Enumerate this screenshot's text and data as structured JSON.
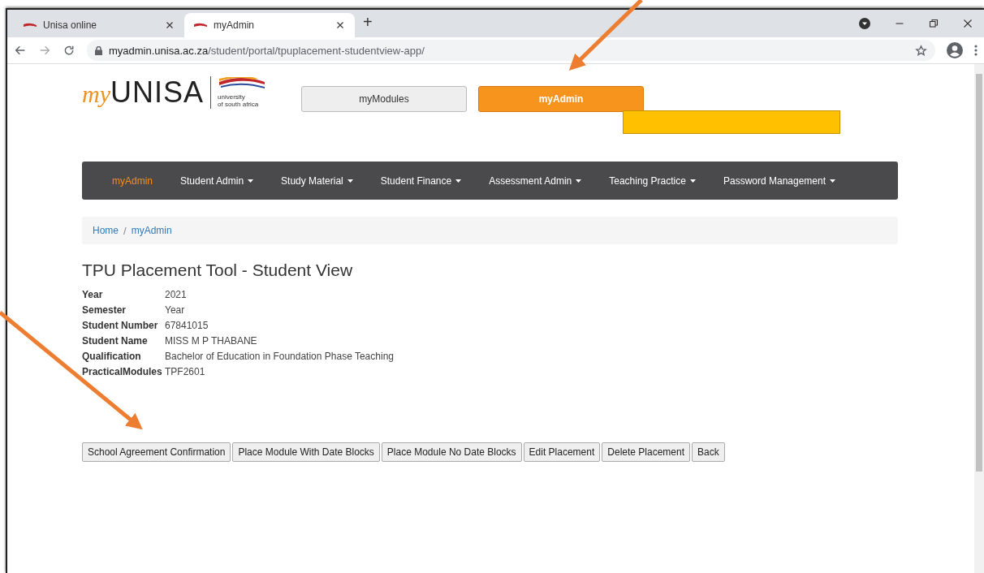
{
  "browser": {
    "tabs": [
      {
        "title": "Unisa online",
        "selected": false
      },
      {
        "title": "myAdmin",
        "selected": true
      }
    ],
    "new_tab": "+",
    "url_host": "myadmin.unisa.ac.za",
    "url_path": "/student/portal/tpuplacement-studentview-app/"
  },
  "header": {
    "logo_my": "my",
    "logo_name": "UNISA",
    "logo_sub": [
      "university",
      "of south africa"
    ],
    "portal_buttons": [
      {
        "label": "myModules",
        "selected": false
      },
      {
        "label": "myAdmin",
        "selected": true
      }
    ]
  },
  "nav": {
    "items": [
      {
        "label": "myAdmin",
        "selected": true,
        "dropdown": false
      },
      {
        "label": "Student Admin",
        "selected": false,
        "dropdown": true
      },
      {
        "label": "Study Material",
        "selected": false,
        "dropdown": true
      },
      {
        "label": "Student Finance",
        "selected": false,
        "dropdown": true
      },
      {
        "label": "Assessment Admin",
        "selected": false,
        "dropdown": true
      },
      {
        "label": "Teaching Practice",
        "selected": false,
        "dropdown": true
      },
      {
        "label": "Password Management",
        "selected": false,
        "dropdown": true
      }
    ]
  },
  "breadcrumb": {
    "separator": "/",
    "items": [
      "Home",
      "myAdmin"
    ]
  },
  "title": "TPU Placement Tool - Student View",
  "details": [
    {
      "label": "Year",
      "value": "2021"
    },
    {
      "label": "Semester",
      "value": "Year"
    },
    {
      "label": "Student Number",
      "value": "67841015"
    },
    {
      "label": "Student Name",
      "value": "MISS M P THABANE"
    },
    {
      "label": "Qualification",
      "value": "Bachelor of Education in Foundation Phase Teaching"
    },
    {
      "label": "PracticalModules",
      "value": "TPF2601"
    }
  ],
  "actions": [
    "School Agreement Confirmation",
    "Place Module With Date Blocks",
    "Place Module No Date Blocks",
    "Edit Placement",
    "Delete Placement",
    "Back"
  ]
}
